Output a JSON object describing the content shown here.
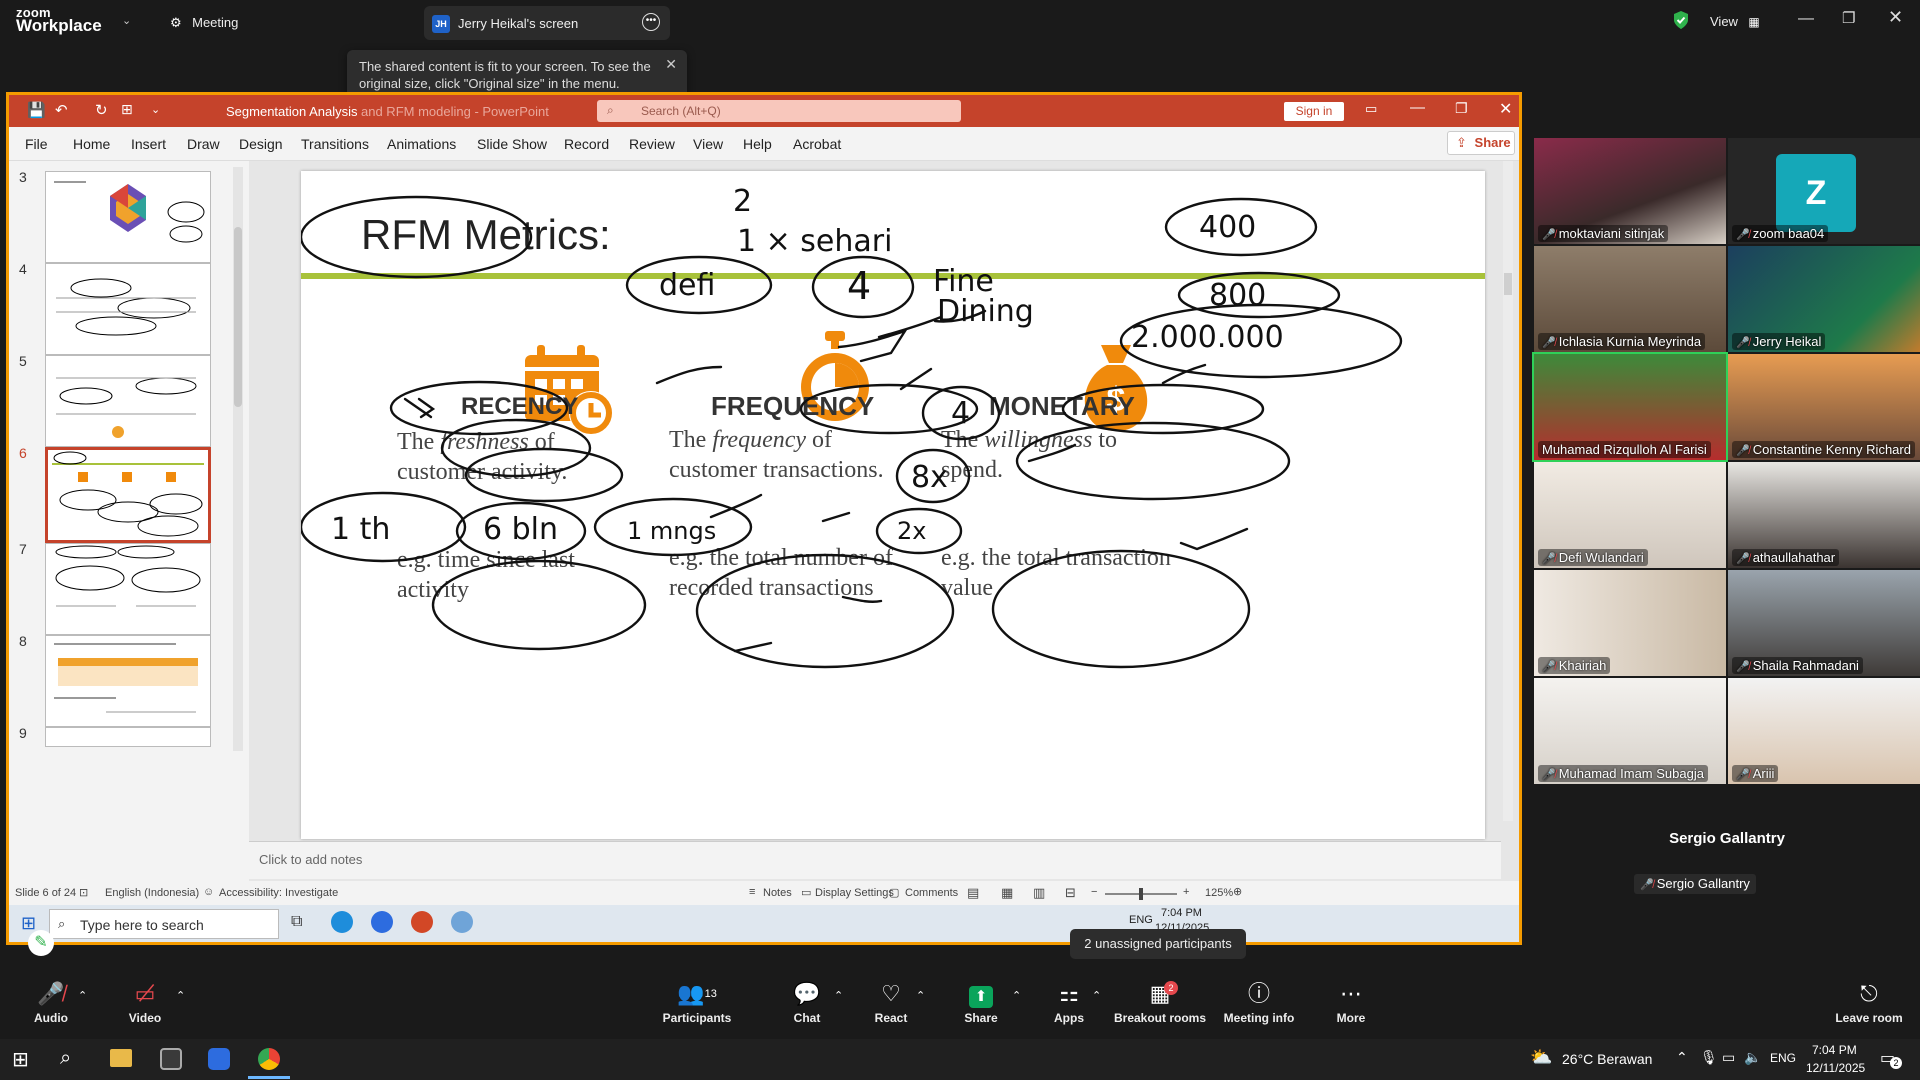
{
  "zoom_top": {
    "logo_line1": "zoom",
    "logo_line2": "Workplace",
    "meeting_label": "Meeting",
    "share_badge": "JH",
    "share_tab": "Jerry Heikal's screen",
    "view_label": "View",
    "tooltip": "The shared content is fit to your screen. To see the original size, click \"Original size\" in the menu."
  },
  "powerpoint": {
    "title": "Segmentation Analysis",
    "title_faded": "and RFM modeling - PowerPoint",
    "search_placeholder": "Search (Alt+Q)",
    "sign_in": "Sign in",
    "share": "Share",
    "menu": [
      "File",
      "Home",
      "Insert",
      "Draw",
      "Design",
      "Transitions",
      "Animations",
      "Slide Show",
      "Record",
      "Review",
      "View",
      "Help",
      "Acrobat"
    ],
    "thumb_numbers": [
      "3",
      "4",
      "5",
      "6",
      "7",
      "8",
      "9"
    ],
    "notes_placeholder": "Click to add notes",
    "status_left": "Slide 6 of 24",
    "status_lang": "English (Indonesia)",
    "status_access": "Accessibility: Investigate",
    "status_notes": "Notes",
    "status_display": "Display Settings",
    "status_comments": "Comments",
    "status_zoom": "125%"
  },
  "slide": {
    "title": "RFM Metrics:",
    "recency_heading": "RECENCY",
    "recency_desc_1": "The ",
    "recency_desc_em": "freshness",
    "recency_desc_2": " of customer activity.",
    "recency_eg": "e.g. time since last activity",
    "frequency_heading": "FREQUENCY",
    "frequency_desc_1": "The ",
    "frequency_desc_em": "frequency",
    "frequency_desc_2": " of customer transactions.",
    "frequency_eg": "e.g. the total number of recorded transactions",
    "monetary_heading": "MONETARY",
    "monetary_desc_1": "The ",
    "monetary_desc_em": "willingness",
    "monetary_desc_2": " to spend.",
    "monetary_eg": "e.g. the total transaction value",
    "ink": {
      "two": "2",
      "one_x_sehari": "1 × sehari",
      "four_hundred": "400",
      "defi": "defi",
      "four": "4",
      "fine": "Fine",
      "dining": "Dining",
      "eight_hundred": "800",
      "two_million": "2.000.000",
      "four_b": "4",
      "eight_x": "8x",
      "two_x": "2x",
      "one_th": "1 th",
      "six_bln": "6 bln",
      "one_mngs": "1 mngs"
    }
  },
  "win_inner_taskbar": {
    "search_placeholder": "Type here to search",
    "lang": "ENG",
    "time": "7:04 PM",
    "date": "12/11/2025"
  },
  "participants_tooltip": "2 unassigned participants",
  "gallery": [
    {
      "name": "moktaviani sitinjak"
    },
    {
      "name": "zoom baa04",
      "initial": "Z"
    },
    {
      "name": "Ichlasia Kurnia Meyrinda"
    },
    {
      "name": "Jerry Heikal"
    },
    {
      "name": "Muhamad Rizqulloh Al Farisi"
    },
    {
      "name": "Constantine Kenny Richard"
    },
    {
      "name": "Defi Wulandari"
    },
    {
      "name": "athaullahathar"
    },
    {
      "name": "Khairiah"
    },
    {
      "name": "Shaila Rahmadani"
    },
    {
      "name": "Muhamad Imam Subagja"
    },
    {
      "name": "Ariii"
    }
  ],
  "self_view": {
    "title": "Sergio Gallantry",
    "badge": "Sergio Gallantry"
  },
  "toolbar": {
    "audio": "Audio",
    "video": "Video",
    "participants": "Participants",
    "participants_count": "13",
    "chat": "Chat",
    "react": "React",
    "share": "Share",
    "apps": "Apps",
    "breakout": "Breakout rooms",
    "breakout_badge": "2",
    "meeting_info": "Meeting info",
    "more": "More",
    "leave": "Leave room"
  },
  "os_taskbar": {
    "weather": "26°C  Berawan",
    "lang": "ENG",
    "time": "7:04 PM",
    "date": "12/11/2025",
    "notif_count": "2"
  },
  "colors": {
    "ppt_red": "#c5432b",
    "share_border": "#f59b00",
    "orange_icon": "#f08a0c",
    "green_rule": "#a8c23a",
    "zoom_blue": "#0e72ed",
    "share_green": "#0aa45b"
  }
}
